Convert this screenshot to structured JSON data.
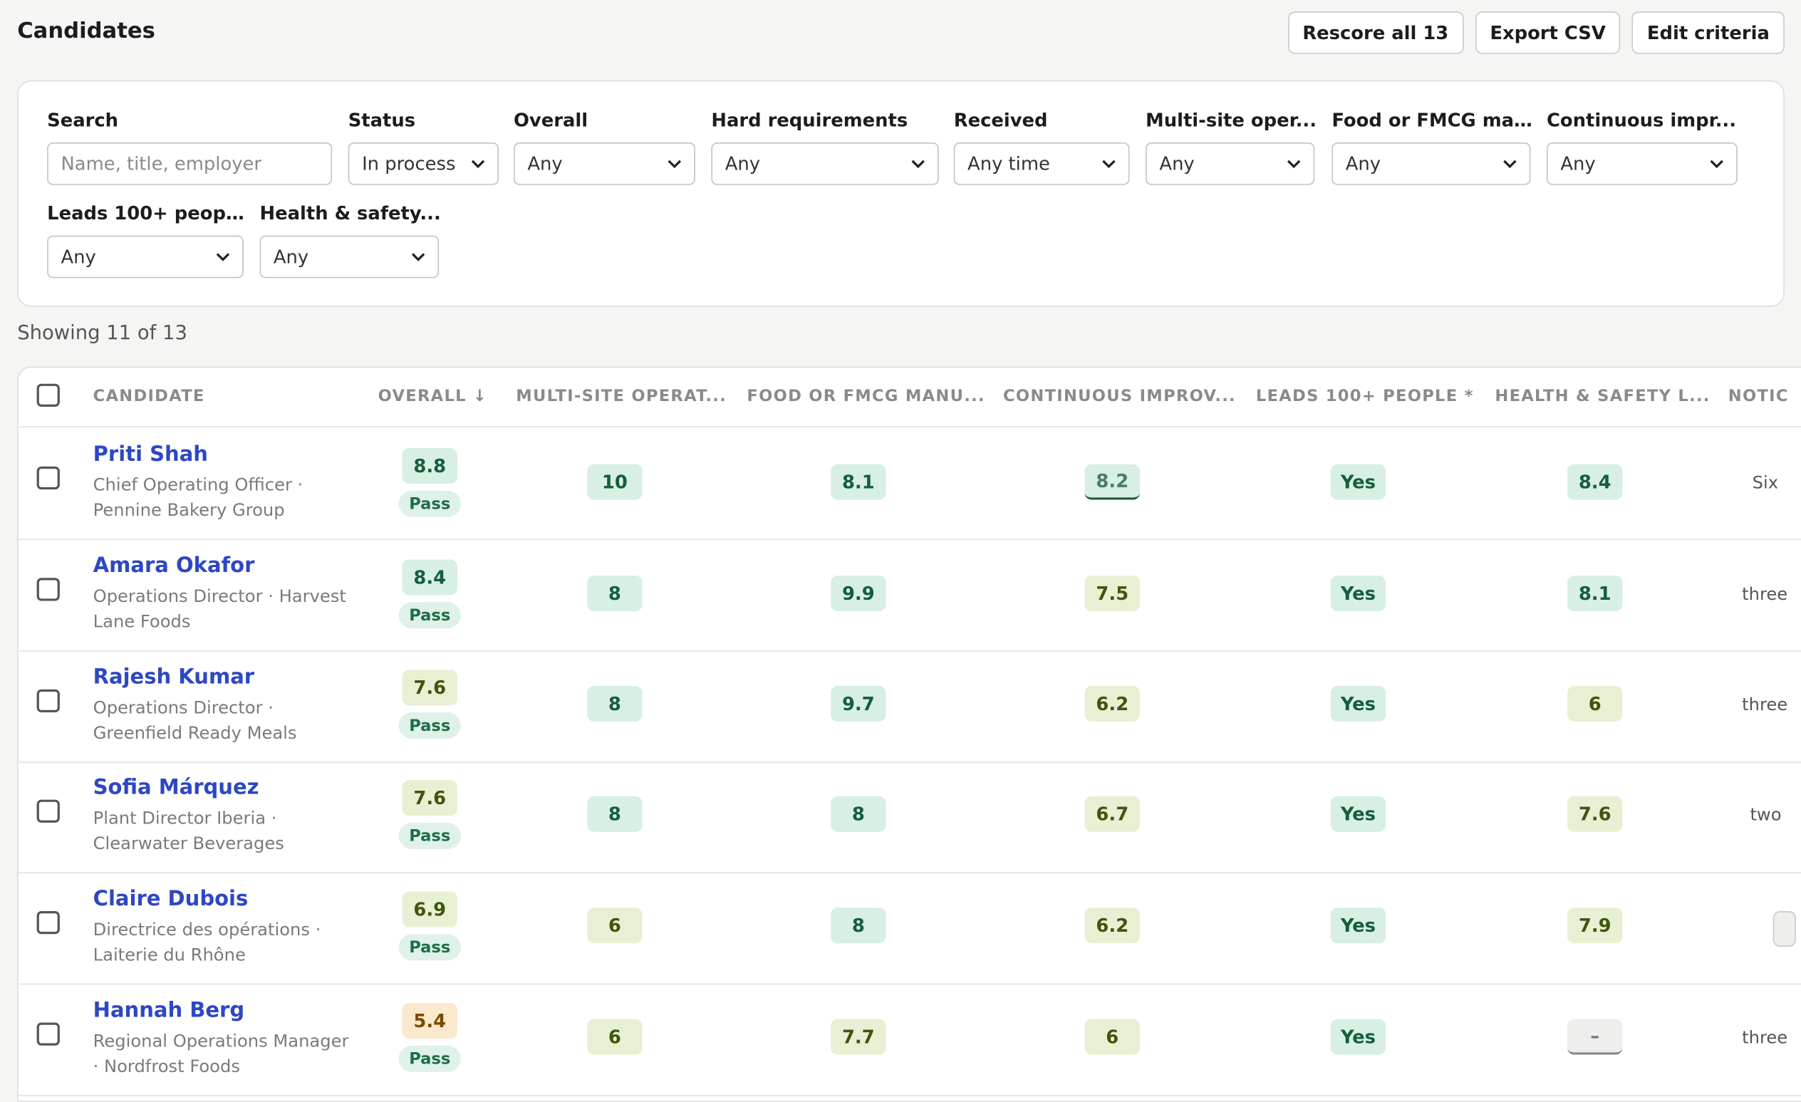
{
  "header": {
    "title": "Candidates",
    "actions": {
      "rescore": "Rescore all 13",
      "export": "Export CSV",
      "edit": "Edit criteria"
    }
  },
  "filters": {
    "search": {
      "label": "Search",
      "placeholder": "Name, title, employer"
    },
    "status": {
      "label": "Status",
      "value": "In process"
    },
    "overall": {
      "label": "Overall",
      "value": "Any"
    },
    "hard": {
      "label": "Hard requirements",
      "value": "Any"
    },
    "received": {
      "label": "Received",
      "value": "Any time"
    },
    "multisite": {
      "label": "Multi-site oper...",
      "value": "Any"
    },
    "food": {
      "label": "Food or FMCG ma...",
      "value": "Any"
    },
    "ci": {
      "label": "Continuous impr...",
      "value": "Any"
    },
    "leads": {
      "label": "Leads 100+ peop...",
      "value": "Any"
    },
    "hs": {
      "label": "Health & safety...",
      "value": "Any"
    }
  },
  "showing": "Showing 11 of 13",
  "table": {
    "headers": {
      "candidate": "CANDIDATE",
      "overall": "OVERALL ↓",
      "multisite": "MULTI-SITE OPERAT...",
      "food": "FOOD OR FMCG MANU...",
      "ci": "CONTINUOUS IMPROV...",
      "leads": "LEADS 100+ PEOPLE *",
      "hs": "HEALTH & SAFETY L...",
      "notice": "NOTIC"
    },
    "rows": [
      {
        "name": "Priti Shah",
        "title": "Chief Operating Officer · Pennine Bakery Group",
        "overall": "8.8",
        "status": "Pass",
        "multisite": "10",
        "food": "8.1",
        "ci": "8.2",
        "leads": "Yes",
        "hs": "8.4",
        "notice": "Six"
      },
      {
        "name": "Amara Okafor",
        "title": "Operations Director · Harvest Lane Foods",
        "overall": "8.4",
        "status": "Pass",
        "multisite": "8",
        "food": "9.9",
        "ci": "7.5",
        "leads": "Yes",
        "hs": "8.1",
        "notice": "three"
      },
      {
        "name": "Rajesh Kumar",
        "title": "Operations Director · Greenfield Ready Meals",
        "overall": "7.6",
        "status": "Pass",
        "multisite": "8",
        "food": "9.7",
        "ci": "6.2",
        "leads": "Yes",
        "hs": "6",
        "notice": "three"
      },
      {
        "name": "Sofia Márquez",
        "title": "Plant Director Iberia · Clearwater Beverages",
        "overall": "7.6",
        "status": "Pass",
        "multisite": "8",
        "food": "8",
        "ci": "6.7",
        "leads": "Yes",
        "hs": "7.6",
        "notice": "two"
      },
      {
        "name": "Claire Dubois",
        "title": "Directrice des opérations · Laiterie du Rhône",
        "overall": "6.9",
        "status": "Pass",
        "multisite": "6",
        "food": "8",
        "ci": "6.2",
        "leads": "Yes",
        "hs": "7.9",
        "notice": ""
      },
      {
        "name": "Hannah Berg",
        "title": "Regional Operations Manager · Nordfrost Foods",
        "overall": "5.4",
        "status": "Pass",
        "multisite": "6",
        "food": "7.7",
        "ci": "6",
        "leads": "Yes",
        "hs": "–",
        "notice": "three"
      }
    ]
  }
}
